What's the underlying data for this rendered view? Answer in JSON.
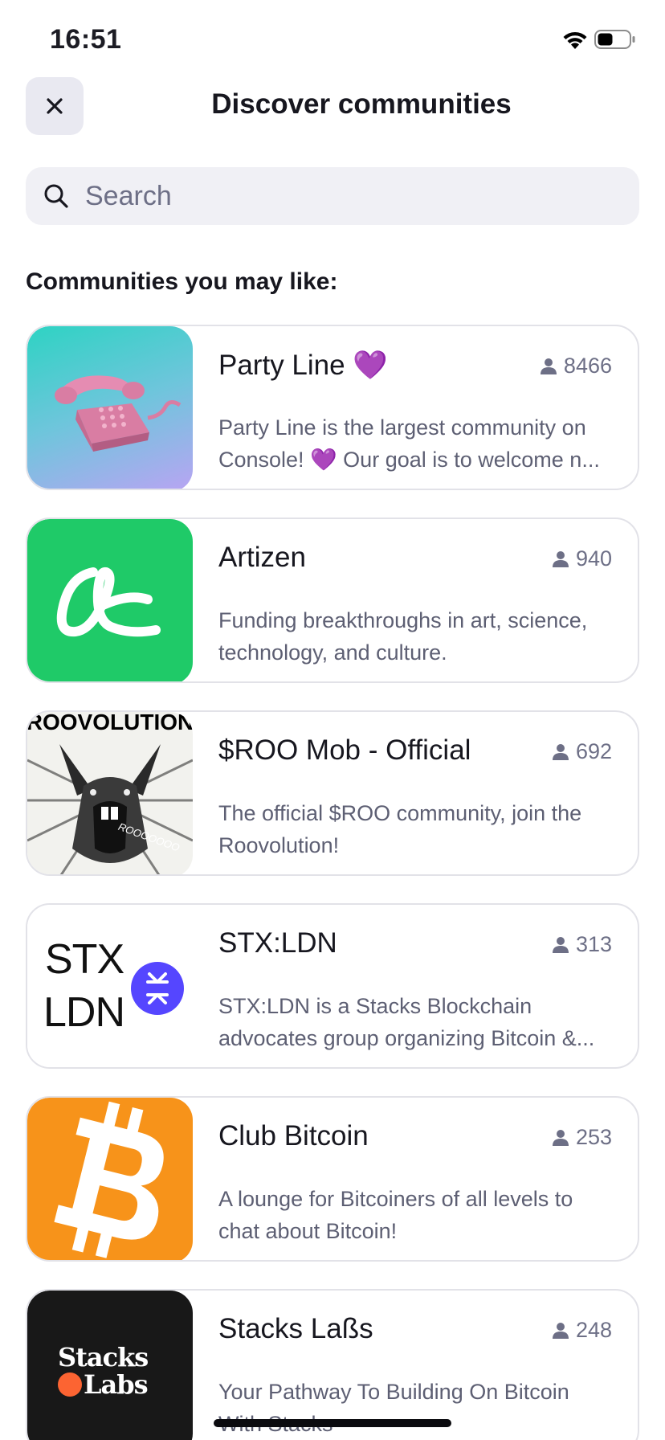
{
  "status_bar": {
    "time": "16:51"
  },
  "header": {
    "title": "Discover communities"
  },
  "search": {
    "placeholder": "Search",
    "value": ""
  },
  "section": {
    "title": "Communities you may like:"
  },
  "thumbnails": {
    "stx_line1": "STX",
    "stx_line2": "LDN",
    "stacks_line1": "Stacks",
    "stacks_line2": "Labs",
    "roo_banner": "ROOVOLUTION",
    "roo_scream": "ROOOOOOO"
  },
  "communities": [
    {
      "name": "Party Line 💜",
      "members": "8466",
      "description": "Party Line is the largest community on Console! 💜 Our goal is to welcome n...",
      "thumb_icon": "rotary-phone-icon"
    },
    {
      "name": "Artizen",
      "members": "940",
      "description": "Funding breakthroughs in art, science, technology, and culture.",
      "thumb_icon": "artizen-logo-icon"
    },
    {
      "name": "$ROO Mob - Official",
      "members": "692",
      "description": "The official $ROO community, join the Roovolution!",
      "thumb_icon": "kangaroo-icon"
    },
    {
      "name": "STX:LDN",
      "members": "313",
      "description": "STX:LDN is a Stacks Blockchain advocates group organizing Bitcoin &...",
      "thumb_icon": "stacks-logo-icon"
    },
    {
      "name": "Club Bitcoin",
      "members": "253",
      "description": "A lounge for Bitcoiners of all levels to chat about Bitcoin!",
      "thumb_icon": "bitcoin-icon"
    },
    {
      "name": "Stacks Laßs",
      "members": "248",
      "description": "Your Pathway To Building On Bitcoin With Stacks",
      "thumb_icon": "stacks-labs-logo-icon"
    }
  ],
  "colors": {
    "artizen_green": "#1fca68",
    "bitcoin_orange": "#f7931a",
    "stacks_purple": "#5546ff",
    "stacks_orange": "#fc6432",
    "muted_text": "#6d6f86"
  }
}
